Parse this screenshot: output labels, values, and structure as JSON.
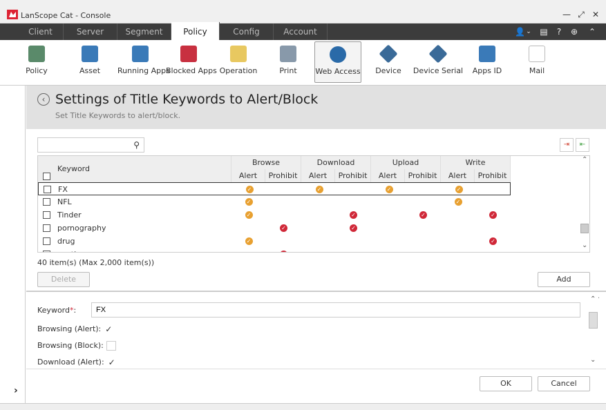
{
  "window": {
    "title": "LanScope Cat - Console",
    "minimize": "—",
    "restore": "⤢",
    "close": "✕"
  },
  "tabs": [
    {
      "label": "Client"
    },
    {
      "label": "Server"
    },
    {
      "label": "Segment"
    },
    {
      "label": "Policy",
      "active": true
    },
    {
      "label": "Config"
    },
    {
      "label": "Account"
    }
  ],
  "tabbar_right": {
    "user": "👤",
    "user_caret": "⌄",
    "list": "▤",
    "help": "?",
    "globe": "⊕",
    "collapse": "⌃"
  },
  "toolbar": [
    {
      "label": "Policy",
      "icon": "policy-icon",
      "color": "#5a8a6a"
    },
    {
      "label": "Asset",
      "icon": "asset-icon",
      "color": "#3a7ab8"
    },
    {
      "label": "Running Apps",
      "icon": "running-apps-icon",
      "color": "#3a7ab8"
    },
    {
      "label": "Blocked Apps",
      "icon": "blocked-apps-icon",
      "color": "#c83040"
    },
    {
      "label": "Operation",
      "icon": "operation-icon",
      "color": "#e8c860"
    },
    {
      "label": "Print",
      "icon": "print-icon",
      "color": "#8899aa"
    },
    {
      "label": "Web Access",
      "icon": "web-access-icon",
      "color": "#2a6aa8",
      "selected": true
    },
    {
      "label": "Device",
      "icon": "device-icon",
      "color": "#3a6a98"
    },
    {
      "label": "Device Serial",
      "icon": "device-serial-icon",
      "color": "#3a6a98"
    },
    {
      "label": "Apps ID",
      "icon": "apps-id-icon",
      "color": "#3a7ab8"
    },
    {
      "label": "Mail",
      "icon": "mail-icon",
      "color": "#cccccc"
    }
  ],
  "header": {
    "title": "Settings of Title Keywords to Alert/Block",
    "subtitle": "Set Title Keywords to alert/block.",
    "back_icon": "‹"
  },
  "search": {
    "value": "",
    "placeholder": "",
    "icon": "⚲"
  },
  "actions": {
    "import": "⇥",
    "export": "⇤"
  },
  "grid": {
    "keyword_header": "Keyword",
    "groups": [
      "Browse",
      "Download",
      "Upload",
      "Write"
    ],
    "sub": [
      "Alert",
      "Prohibit"
    ],
    "rows": [
      {
        "keyword": "FX",
        "marks": [
          "A",
          "",
          "A",
          "",
          "A",
          "",
          "A",
          ""
        ],
        "selected": true
      },
      {
        "keyword": "NFL",
        "marks": [
          "A",
          "",
          "",
          "",
          "",
          "",
          "A",
          ""
        ]
      },
      {
        "keyword": "Tinder",
        "marks": [
          "A",
          "",
          "",
          "P",
          "",
          "P",
          "",
          "P"
        ]
      },
      {
        "keyword": "pornography",
        "marks": [
          "",
          "P",
          "",
          "P",
          "",
          "",
          "",
          ""
        ]
      },
      {
        "keyword": "drug",
        "marks": [
          "A",
          "",
          "",
          "",
          "",
          "",
          "",
          "P"
        ]
      },
      {
        "keyword": "auction",
        "marks": [
          "",
          "P",
          "",
          "",
          "",
          "",
          "",
          ""
        ]
      }
    ],
    "scroll_up": "⌃",
    "scroll_down": "⌄"
  },
  "count_text": "40 item(s) (Max 2,000 item(s))",
  "buttons": {
    "delete": "Delete",
    "add": "Add",
    "ok": "OK",
    "cancel": "Cancel"
  },
  "form": {
    "keyword_label": "Keyword",
    "keyword_required": "*",
    "keyword_colon": ":",
    "keyword_value": "FX",
    "fields": [
      {
        "label": "Browsing (Alert):",
        "checked": true
      },
      {
        "label": "Browsing (Block):",
        "checked": false
      },
      {
        "label": "Download (Alert):",
        "checked": true
      }
    ],
    "collapse_icon": "⌄",
    "scroll_up": "⌃",
    "scroll_down": "⌄"
  },
  "left_expander": "›",
  "colors": {
    "alert": "#e8a030",
    "prohibit": "#d02838",
    "tabbar": "#3c3c3c"
  }
}
